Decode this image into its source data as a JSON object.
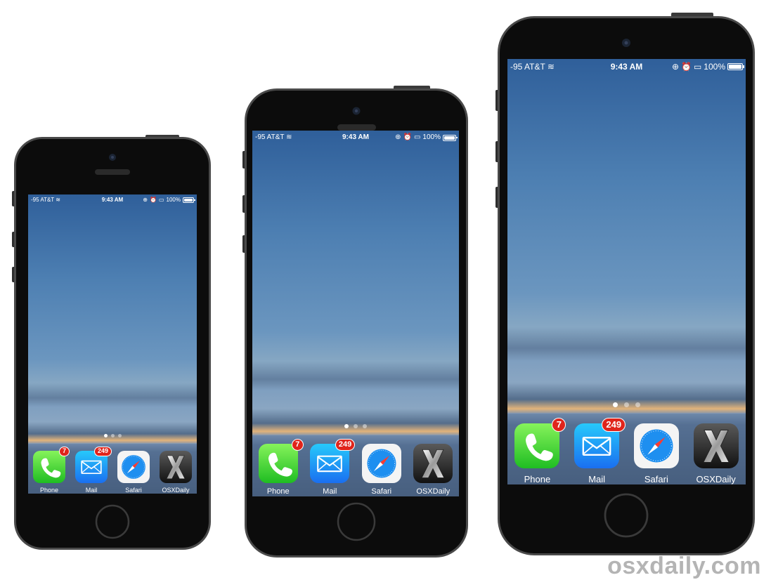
{
  "status_bar": {
    "carrier": "-95 AT&T",
    "time": "9:43 AM",
    "battery": "100%"
  },
  "page_indicator": {
    "count": 3,
    "active_index": 0
  },
  "dock_apps": [
    {
      "label": "Phone",
      "badge": "7",
      "icon": "phone-icon"
    },
    {
      "label": "Mail",
      "badge": "249",
      "icon": "mail-icon"
    },
    {
      "label": "Safari",
      "badge": "",
      "icon": "compass-icon"
    },
    {
      "label": "OSXDaily",
      "badge": "",
      "icon": "x-logo-icon"
    }
  ],
  "phones": [
    {
      "id": "small"
    },
    {
      "id": "medium"
    },
    {
      "id": "large"
    }
  ],
  "watermark": "osxdaily.com"
}
